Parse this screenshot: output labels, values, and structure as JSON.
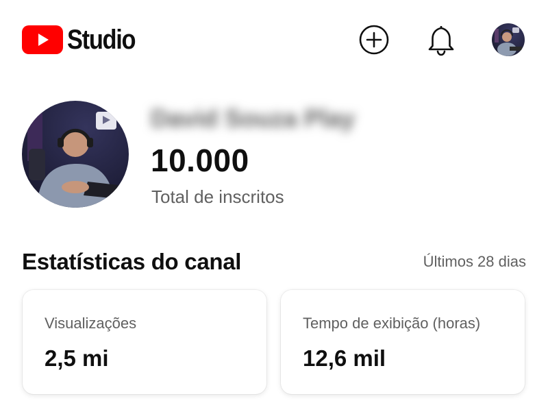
{
  "header": {
    "brand_text": "Studio",
    "logo_icon": "youtube-logo-icon",
    "create_icon": "add-circle-icon",
    "notifications_icon": "bell-icon",
    "account_icon": "avatar"
  },
  "channel": {
    "name": "David Souza Play",
    "subscriber_count": "10.000",
    "subscriber_label": "Total de inscritos"
  },
  "stats": {
    "title": "Estatísticas do canal",
    "period": "Últimos 28 dias",
    "cards": [
      {
        "label": "Visualizações",
        "value": "2,5 mi"
      },
      {
        "label": "Tempo de exibição (horas)",
        "value": "12,6 mil"
      }
    ]
  },
  "colors": {
    "brand_red": "#FF0000",
    "text_primary": "#0F0F0F",
    "text_secondary": "#606060",
    "background": "#FFFFFF"
  }
}
